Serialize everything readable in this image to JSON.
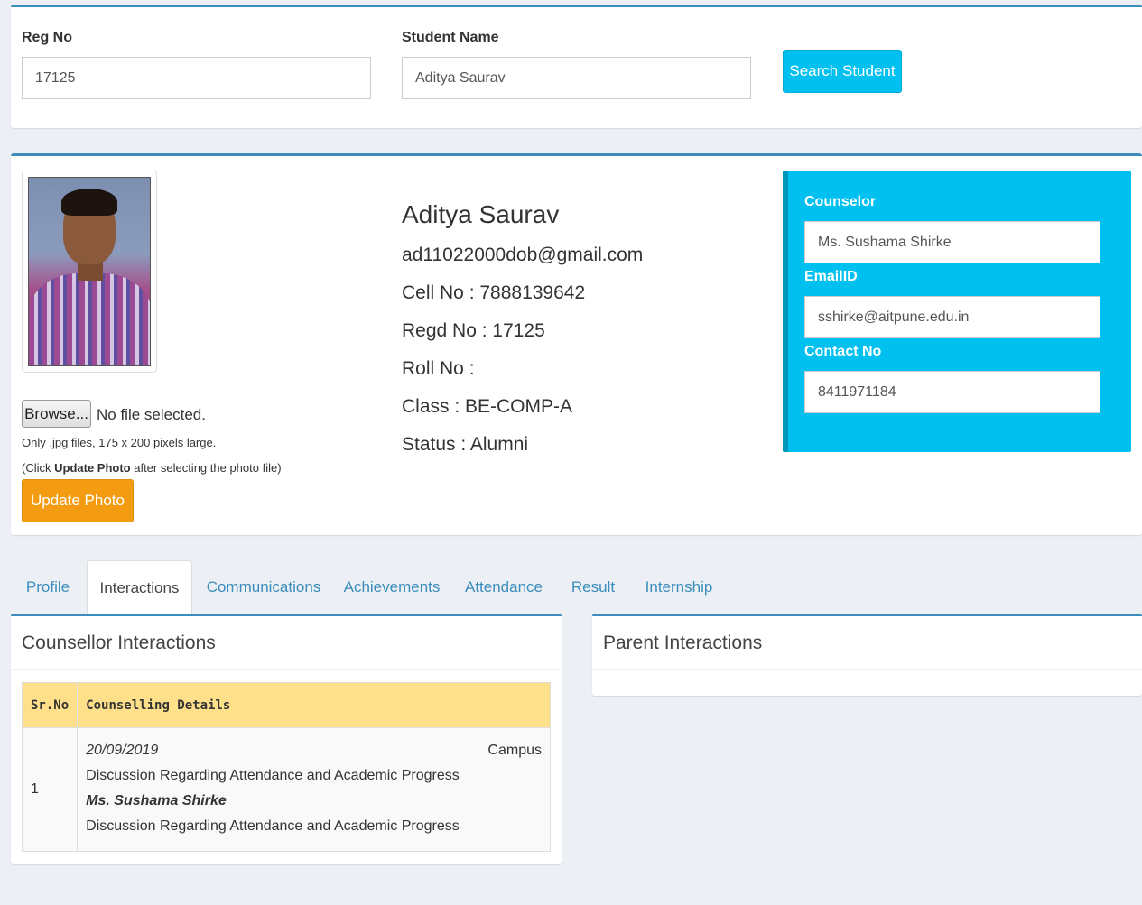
{
  "search": {
    "reg_no_label": "Reg No",
    "reg_no_value": "17125",
    "student_name_label": "Student Name",
    "student_name_value": "Aditya Saurav",
    "search_button": "Search Student"
  },
  "profile": {
    "name": "Aditya Saurav",
    "email": "ad11022000dob@gmail.com",
    "cell_no": "Cell No : 7888139642",
    "regd_no": "Regd No : 17125",
    "roll_no": "Roll No :",
    "class": "Class : BE-COMP-A",
    "status": "Status : Alumni"
  },
  "photo": {
    "browse_label": "Browse...",
    "file_status": "No file selected.",
    "hint_size": "Only .jpg files, 175 x 200 pixels large.",
    "hint_click_prefix": "(Click ",
    "hint_click_bold": "Update Photo",
    "hint_click_suffix": " after selecting the photo file)",
    "update_button": "Update Photo"
  },
  "counselor": {
    "counselor_label": "Counselor",
    "counselor_value": "Ms. Sushama Shirke",
    "email_label": "EmailID",
    "email_value": "sshirke@aitpune.edu.in",
    "contact_label": "Contact No",
    "contact_value": "8411971184"
  },
  "tabs": [
    {
      "label": "Profile"
    },
    {
      "label": "Interactions"
    },
    {
      "label": "Communications"
    },
    {
      "label": "Achievements"
    },
    {
      "label": "Attendance"
    },
    {
      "label": "Result"
    },
    {
      "label": "Internship"
    }
  ],
  "counsellor_interactions": {
    "title": "Counsellor Interactions",
    "headers": [
      "Sr.No",
      "Counselling Details"
    ],
    "rows": [
      {
        "sr": "1",
        "date": "20/09/2019",
        "mode": "Campus",
        "topic": "Discussion Regarding Attendance and Academic Progress",
        "counsellor": "Ms. Sushama Shirke",
        "details": "Discussion Regarding Attendance and Academic Progress"
      }
    ]
  },
  "parent_interactions": {
    "title": "Parent Interactions"
  },
  "colors": {
    "primary_border": "#3c8dbc",
    "info": "#00c0ef",
    "warning": "#f39c12",
    "table_header": "#ffe08a"
  }
}
